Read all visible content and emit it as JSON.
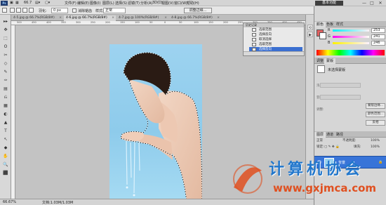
{
  "app": {
    "logo": "Ps"
  },
  "menubar": {
    "items": [
      "文件(F)",
      "编辑(E)",
      "图像(I)",
      "图层(L)",
      "选择(S)",
      "滤镜(T)",
      "分析(A)",
      "3D(D)",
      "视图(V)",
      "窗口(W)",
      "帮助(H)"
    ],
    "zoom": "66.7",
    "workspace_label": "基本功能",
    "window_controls": [
      "—",
      "□",
      "✕"
    ]
  },
  "options_bar": {
    "feather_label": "羽化:",
    "feather_value": "0 px",
    "antialias_label": "消除锯齿",
    "style_label": "样式:",
    "style_value": "正常",
    "refine_edge_label": "调整边缘..."
  },
  "tabs": [
    {
      "label": "4-5.jpg @ 66.7%(RGB/8#)",
      "close": "×",
      "active": false
    },
    {
      "label": "4-6.jpg @ 66.7%(RGB/8#)",
      "close": "×",
      "active": true
    },
    {
      "label": "4-7.jpg @ 100%(RGB/8#)",
      "close": "×",
      "active": false
    },
    {
      "label": "4-8.jpg @ 66.7%(RGB/8#)",
      "close": "×",
      "active": false
    }
  ],
  "toolbox": {
    "tools": [
      "▸▸",
      "✥",
      "⬚",
      "ʘ",
      "✂",
      "◇",
      "✎",
      "✑",
      "▤",
      "⎌",
      "▦",
      "◐",
      "▲",
      "T",
      "↖",
      "◆",
      "✋",
      "🔍",
      "⬛"
    ]
  },
  "rulers": {
    "top_ticks": [
      "500",
      "450",
      "400",
      "350",
      "300",
      "250",
      "200",
      "150",
      "100",
      "50",
      "0",
      "50",
      "100",
      "150",
      "200",
      "250",
      "300",
      "350",
      "400",
      "450"
    ]
  },
  "history": {
    "header": "历史记录",
    "items": [
      {
        "label": "选取范围",
        "selected": false
      },
      {
        "label": "选择反向",
        "selected": false
      },
      {
        "label": "取消选择",
        "selected": false
      },
      {
        "label": "选取范围",
        "selected": false
      },
      {
        "label": "选择反向",
        "selected": true
      }
    ]
  },
  "status": {
    "zoom": "66.67%",
    "doc_info": "文档:1.03M/1.03M"
  },
  "color_panel": {
    "tabs": [
      "颜色",
      "色板",
      "样式"
    ],
    "channels": [
      {
        "label": "R",
        "value": "253"
      },
      {
        "label": "G",
        "value": "241"
      },
      {
        "label": "B",
        "value": "246"
      }
    ],
    "foreground": "#e06060",
    "background": "#ffffff"
  },
  "adjust_panel": {
    "tabs": [
      "调整",
      "蒙版"
    ],
    "title": "未选择蒙版",
    "density_label": "浓度:",
    "feather_label": "羽化:",
    "refine_label": "调整:",
    "buttons": [
      "蒙版边缘...",
      "颜色范围...",
      "反相"
    ]
  },
  "layers_panel": {
    "tabs": [
      "图层",
      "通道",
      "路径"
    ],
    "mode": "正常",
    "opacity_label": "不透明度:",
    "opacity_value": "100%",
    "lock_label": "锁定:",
    "fill_label": "填充:",
    "fill_value": "100%",
    "layer": {
      "name": "背景",
      "visible_icon": "👁",
      "lock_icon": "🔒"
    }
  },
  "watermark": {
    "title": "计算机协会",
    "url": "www.gxjmca.com"
  },
  "colors": {
    "canvas_bg": "#c3c3c3",
    "selection": "#3874d8",
    "accent": "#2277cc"
  }
}
